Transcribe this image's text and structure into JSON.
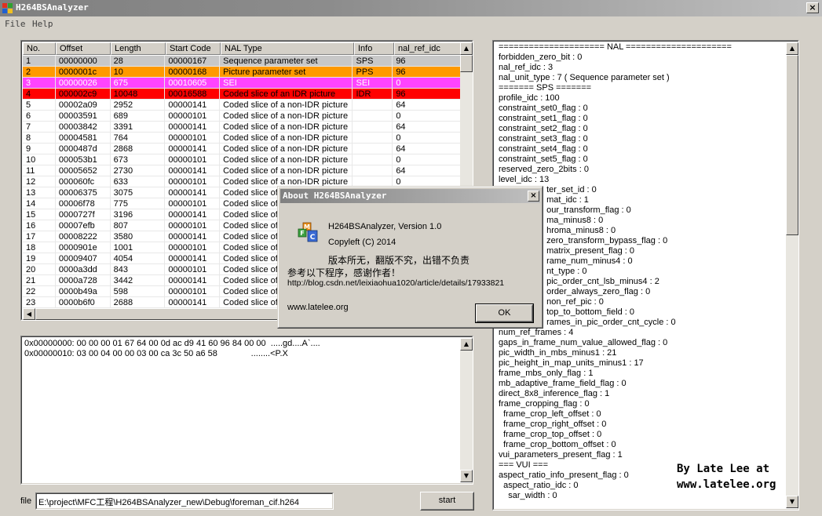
{
  "window": {
    "title": "H264BSAnalyzer",
    "close_glyph": "×"
  },
  "menu": {
    "items": [
      "File",
      "Help"
    ]
  },
  "nal_table": {
    "columns": [
      "No.",
      "Offset",
      "Length",
      "Start Code",
      "NAL Type",
      "Info",
      "nal_ref_idc"
    ],
    "rows": [
      {
        "no": "1",
        "offset": "00000000",
        "length": "28",
        "start_code": "00000167",
        "type": "Sequence parameter set",
        "info": "SPS",
        "ref": "96",
        "color": "#c8c8c8",
        "text": "#000000"
      },
      {
        "no": "2",
        "offset": "0000001c",
        "length": "10",
        "start_code": "00000168",
        "type": "Picture parameter set",
        "info": "PPS",
        "ref": "96",
        "color": "#ff9900",
        "text": "#000000"
      },
      {
        "no": "3",
        "offset": "00000026",
        "length": "675",
        "start_code": "00010605",
        "type": "SEI",
        "info": "SEI",
        "ref": "0",
        "color": "#ff44ff",
        "text": "#ffffff"
      },
      {
        "no": "4",
        "offset": "000002c9",
        "length": "10048",
        "start_code": "00016588",
        "type": "Coded slice of an IDR picture",
        "info": "IDR",
        "ref": "96",
        "color": "#ff0000",
        "text": "#000000"
      },
      {
        "no": "5",
        "offset": "00002a09",
        "length": "2952",
        "start_code": "00000141",
        "type": "Coded slice of a non-IDR picture",
        "info": "",
        "ref": "64",
        "color": "#ffffff",
        "text": "#000000"
      },
      {
        "no": "6",
        "offset": "00003591",
        "length": "689",
        "start_code": "00000101",
        "type": "Coded slice of a non-IDR picture",
        "info": "",
        "ref": "0",
        "color": "#ffffff",
        "text": "#000000"
      },
      {
        "no": "7",
        "offset": "00003842",
        "length": "3391",
        "start_code": "00000141",
        "type": "Coded slice of a non-IDR picture",
        "info": "",
        "ref": "64",
        "color": "#ffffff",
        "text": "#000000"
      },
      {
        "no": "8",
        "offset": "00004581",
        "length": "764",
        "start_code": "00000101",
        "type": "Coded slice of a non-IDR picture",
        "info": "",
        "ref": "0",
        "color": "#ffffff",
        "text": "#000000"
      },
      {
        "no": "9",
        "offset": "0000487d",
        "length": "2868",
        "start_code": "00000141",
        "type": "Coded slice of a non-IDR picture",
        "info": "",
        "ref": "64",
        "color": "#ffffff",
        "text": "#000000"
      },
      {
        "no": "10",
        "offset": "000053b1",
        "length": "673",
        "start_code": "00000101",
        "type": "Coded slice of a non-IDR picture",
        "info": "",
        "ref": "0",
        "color": "#ffffff",
        "text": "#000000"
      },
      {
        "no": "11",
        "offset": "00005652",
        "length": "2730",
        "start_code": "00000141",
        "type": "Coded slice of a non-IDR picture",
        "info": "",
        "ref": "64",
        "color": "#ffffff",
        "text": "#000000"
      },
      {
        "no": "12",
        "offset": "000060fc",
        "length": "633",
        "start_code": "00000101",
        "type": "Coded slice of a non-IDR picture",
        "info": "",
        "ref": "0",
        "color": "#ffffff",
        "text": "#000000"
      },
      {
        "no": "13",
        "offset": "00006375",
        "length": "3075",
        "start_code": "00000141",
        "type": "Coded slice of",
        "info": "",
        "ref": "",
        "color": "#ffffff",
        "text": "#000000"
      },
      {
        "no": "14",
        "offset": "00006f78",
        "length": "775",
        "start_code": "00000101",
        "type": "Coded slice of",
        "info": "",
        "ref": "",
        "color": "#ffffff",
        "text": "#000000"
      },
      {
        "no": "15",
        "offset": "0000727f",
        "length": "3196",
        "start_code": "00000141",
        "type": "Coded slice of",
        "info": "",
        "ref": "",
        "color": "#ffffff",
        "text": "#000000"
      },
      {
        "no": "16",
        "offset": "00007efb",
        "length": "807",
        "start_code": "00000101",
        "type": "Coded slice of",
        "info": "",
        "ref": "",
        "color": "#ffffff",
        "text": "#000000"
      },
      {
        "no": "17",
        "offset": "00008222",
        "length": "3580",
        "start_code": "00000141",
        "type": "Coded slice of",
        "info": "",
        "ref": "",
        "color": "#ffffff",
        "text": "#000000"
      },
      {
        "no": "18",
        "offset": "0000901e",
        "length": "1001",
        "start_code": "00000101",
        "type": "Coded slice of",
        "info": "",
        "ref": "",
        "color": "#ffffff",
        "text": "#000000"
      },
      {
        "no": "19",
        "offset": "00009407",
        "length": "4054",
        "start_code": "00000141",
        "type": "Coded slice of",
        "info": "",
        "ref": "",
        "color": "#ffffff",
        "text": "#000000"
      },
      {
        "no": "20",
        "offset": "0000a3dd",
        "length": "843",
        "start_code": "00000101",
        "type": "Coded slice of",
        "info": "",
        "ref": "",
        "color": "#ffffff",
        "text": "#000000"
      },
      {
        "no": "21",
        "offset": "0000a728",
        "length": "3442",
        "start_code": "00000141",
        "type": "Coded slice of",
        "info": "",
        "ref": "",
        "color": "#ffffff",
        "text": "#000000"
      },
      {
        "no": "22",
        "offset": "0000b49a",
        "length": "598",
        "start_code": "00000101",
        "type": "Coded slice of",
        "info": "",
        "ref": "",
        "color": "#ffffff",
        "text": "#000000"
      },
      {
        "no": "23",
        "offset": "0000b6f0",
        "length": "2688",
        "start_code": "00000141",
        "type": "Coded slice of",
        "info": "",
        "ref": "",
        "color": "#ffffff",
        "text": "#000000"
      }
    ]
  },
  "hex_view": {
    "lines": [
      "0x00000000: 00 00 00 01 67 64 00 0d ac d9 41 60 96 84 00 00  .....gd....A`....",
      "0x00000010: 03 00 04 00 00 03 00 ca 3c 50 a6 58              ........<P.X"
    ]
  },
  "detail_panel": {
    "lines": [
      "===================== NAL =====================",
      "forbidden_zero_bit : 0",
      "nal_ref_idc : 3",
      "nal_unit_type : 7 ( Sequence parameter set )",
      "======= SPS =======",
      "profile_idc : 100",
      "constraint_set0_flag : 0",
      "constraint_set1_flag : 0",
      "constraint_set2_flag : 0",
      "constraint_set3_flag : 0",
      "constraint_set4_flag : 0",
      "constraint_set5_flag : 0",
      "reserved_zero_2bits : 0",
      "level_idc : 13",
      "                    ter_set_id : 0",
      "                    mat_idc : 1",
      "                    our_transform_flag : 0",
      "                    ma_minus8 : 0",
      "                    hroma_minus8 : 0",
      "                    zero_transform_bypass_flag : 0",
      "                    matrix_present_flag : 0",
      "                    rame_num_minus4 : 0",
      "                    nt_type : 0",
      "                    pic_order_cnt_lsb_minus4 : 2",
      "                    order_always_zero_flag : 0",
      "                    non_ref_pic : 0",
      "                    top_to_bottom_field : 0",
      "                    rames_in_pic_order_cnt_cycle : 0",
      "num_ref_frames : 4",
      "gaps_in_frame_num_value_allowed_flag : 0",
      "pic_width_in_mbs_minus1 : 21",
      "pic_height_in_map_units_minus1 : 17",
      "frame_mbs_only_flag : 1",
      "mb_adaptive_frame_field_flag : 0",
      "direct_8x8_inference_flag : 1",
      "frame_cropping_flag : 0",
      "  frame_crop_left_offset : 0",
      "  frame_crop_right_offset : 0",
      "  frame_crop_top_offset : 0",
      "  frame_crop_bottom_offset : 0",
      "vui_parameters_present_flag : 1",
      "=== VUI ===",
      "aspect_ratio_info_present_flag : 0",
      "  aspect_ratio_idc : 0",
      "    sar_width : 0"
    ]
  },
  "watermark": {
    "line1": "By Late Lee at",
    "line2": "www.latelee.org"
  },
  "file_row": {
    "label": "file",
    "path": "E:\\project\\MFC工程\\H264BSAnalyzer_new\\Debug\\foreman_cif.h264",
    "start_label": "start"
  },
  "about_dialog": {
    "title": "About H264BSAnalyzer",
    "close_glyph": "×",
    "version": "H264BSAnalyzer, Version 1.0",
    "copyleft": "Copyleft (C) 2014",
    "rights": "版本所无，翻版不究，出错不负责",
    "reference": "参考以下程序，感谢作者！",
    "url": "http://blog.csdn.net/leixiaohua1020/article/details/17933821",
    "site": "www.latelee.org",
    "ok_label": "OK"
  }
}
